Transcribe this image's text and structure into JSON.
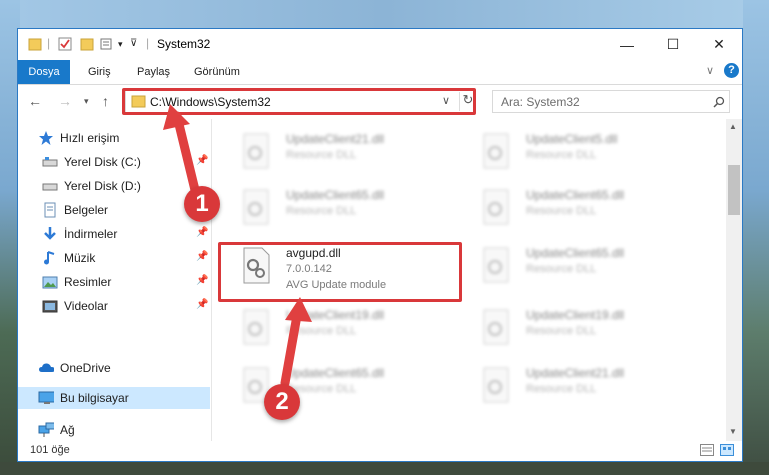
{
  "window": {
    "title": "System32",
    "minimize_glyph": "—",
    "maximize_glyph": "☐",
    "close_glyph": "✕"
  },
  "ribbon": {
    "tabs": [
      "Dosya",
      "Giriş",
      "Paylaş",
      "Görünüm"
    ],
    "expand_glyph": "∨",
    "help_glyph": "?"
  },
  "address": {
    "path": "C:\\Windows\\System32",
    "dropdown_glyph": "∨",
    "refresh_glyph": "↻"
  },
  "search": {
    "placeholder": "Ara: System32"
  },
  "nav": {
    "quick_access": "Hızlı erişim",
    "items": [
      {
        "label": "Yerel Disk (C:)",
        "icon": "drive-icon",
        "pinned": true
      },
      {
        "label": "Yerel Disk (D:)",
        "icon": "drive-icon",
        "pinned": false
      },
      {
        "label": "Belgeler",
        "icon": "documents-icon",
        "pinned": true
      },
      {
        "label": "İndirmeler",
        "icon": "download-icon",
        "pinned": true
      },
      {
        "label": "Müzik",
        "icon": "music-icon",
        "pinned": true
      },
      {
        "label": "Resimler",
        "icon": "pictures-icon",
        "pinned": true
      },
      {
        "label": "Videolar",
        "icon": "videos-icon",
        "pinned": true
      }
    ],
    "onedrive": "OneDrive",
    "this_pc": "Bu bilgisayar",
    "network": "Ağ",
    "pin_glyph": "📌"
  },
  "files": {
    "highlighted": {
      "name": "avgupd.dll",
      "version": "7.0.0.142",
      "description": "AVG Update module"
    },
    "blurred": [
      {
        "name": "UpdateClient21.dll",
        "sub": "Resource DLL"
      },
      {
        "name": "UpdateClient5.dll",
        "sub": "Resource DLL"
      },
      {
        "name": "UpdateClient65.dll",
        "sub": "Resource DLL"
      },
      {
        "name": "UpdateClient65.dll",
        "sub": "Resource DLL"
      },
      {
        "name": "UpdateClient65.dll",
        "sub": "Resource DLL"
      },
      {
        "name": "UpdateClient19.dll",
        "sub": "Resource DLL"
      },
      {
        "name": "UpdateClient19.dll",
        "sub": "Resource DLL"
      },
      {
        "name": "UpdateClient65.dll",
        "sub": "Resource DLL"
      },
      {
        "name": "UpdateClient21.dll",
        "sub": "Resource DLL"
      }
    ]
  },
  "status": {
    "count": "101 öğe"
  },
  "annotations": {
    "step1": "1",
    "step2": "2"
  },
  "colors": {
    "accent": "#1979ca",
    "highlight": "#d9383a",
    "selected": "#cce8ff"
  }
}
